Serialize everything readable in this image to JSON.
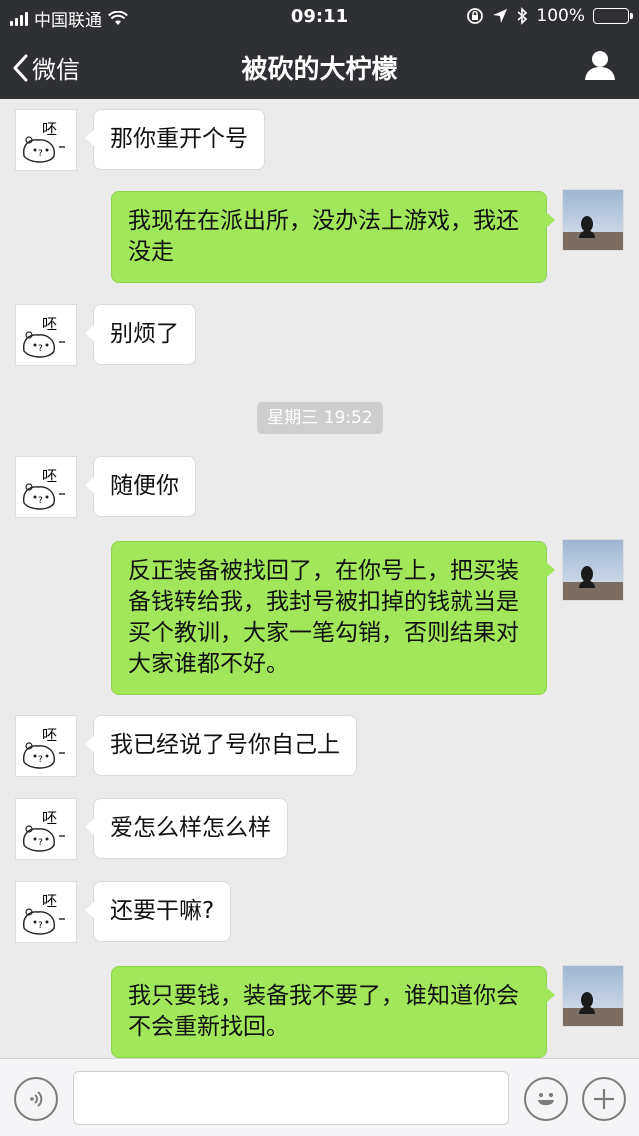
{
  "status_bar": {
    "carrier": "中国联通",
    "time": "09:11",
    "battery": "100%"
  },
  "nav": {
    "back_label": "微信",
    "title": "被砍的大柠檬"
  },
  "contact_avatar_text": "呸",
  "messages": [
    {
      "side": "in",
      "text": "那你重开个号"
    },
    {
      "side": "out",
      "text": "我现在在派出所，没办法上游戏，我还没走"
    },
    {
      "side": "in",
      "text": "别烦了"
    },
    {
      "side": "in",
      "text": "随便你"
    },
    {
      "side": "out",
      "text": "反正装备被找回了，在你号上，把买装备钱转给我，我封号被扣掉的钱就当是买个教训，大家一笔勾销，否则结果对大家谁都不好。"
    },
    {
      "side": "in",
      "text": "我已经说了号你自己上"
    },
    {
      "side": "in",
      "text": "爱怎么样怎么样"
    },
    {
      "side": "in",
      "text": "还要干嘛?"
    },
    {
      "side": "out",
      "text": "我只要钱，装备我不要了，谁知道你会不会重新找回。"
    }
  ],
  "timestamp": "星期三 19:52",
  "input": {
    "value": "",
    "placeholder": ""
  }
}
